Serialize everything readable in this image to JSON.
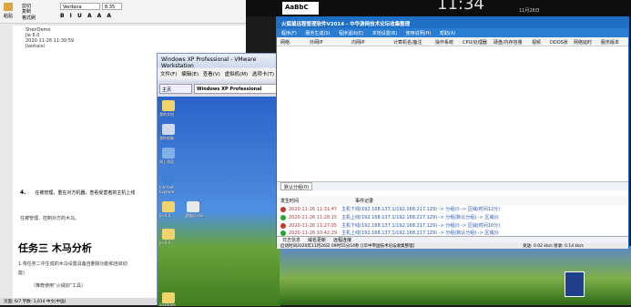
{
  "desktop": {
    "style_sample": "AaBbC",
    "clock_partial": "11:34",
    "date_partial": "11月26日"
  },
  "word": {
    "toolbar": {
      "paste": "粘贴",
      "cut": "剪切",
      "copy": "复制",
      "format_painter": "格式刷",
      "font_name": "Verdana",
      "font_size": "8.35"
    },
    "lines": {
      "l1": "ShenDemo",
      "l2": "Jie 6.0",
      "l3": "2020-11-26  11:30:59",
      "l4": "Jiaohaixi",
      "step4_num": "4.",
      "step4": "在被管理，重在对方机器，查看受害者的主机上线",
      "admin_note": "在被管理，控制对方的木马。",
      "heading": "任务三  木马分析",
      "p1": "1.将任务二中生成的木马设置具备自删除功能和自启动",
      "p2": "能)",
      "p3": "（推荐使用“火绒剑”工具）",
      "status": "页面: 6/7    字数: 1,014    中文(中国)"
    }
  },
  "vmware": {
    "title": "Windows XP Professional - VMware Workstation",
    "menu": [
      "文件(F)",
      "编辑(E)",
      "查看(V)",
      "虚拟机(M)",
      "选项卡(T)"
    ],
    "tabs": [
      "主页",
      "Windows XP Professional"
    ],
    "icons": [
      "我的文档",
      "我的电脑",
      "网上邻居",
      "Internet Explorer",
      "Jie 6.0",
      "国服机.exe",
      "Jie 6.0",
      "Shadows"
    ]
  },
  "app": {
    "title": "火狐鼠远程管理软件V2014  - 中华游网技术论坛收集整理",
    "menu": [
      "程序(F)",
      "服务生成(S)",
      "程序退出(E)",
      "本地设置(B)",
      "使用说明(H)",
      "帮助(A)"
    ],
    "columns": [
      "网络",
      "外网IP",
      "内网IP",
      "计算机名/备注",
      "操作系统",
      "CPU/处理器",
      "硬盘/内存容量",
      "视频",
      "DDOS状",
      "网络延时",
      "服务版本"
    ],
    "group_tab": "默认分组(0)",
    "log_headers": {
      "time": "发生时间",
      "event": "事件记录"
    },
    "log": [
      {
        "time": "2020-11-26 11:31:47",
        "event": "主机下线(192.168.137.1/192.168.217.129) -> 分组(I) -> 区域(时间12分)",
        "color": "#c0392b"
      },
      {
        "time": "2020-11-26 11:28:15",
        "event": "主机上线(192.168.137.1/192.168.217.129) -> 分组(默认分组) -> 区域(I)",
        "color": "#27a533"
      },
      {
        "time": "2020-11-26 11:27:05",
        "event": "主机下线(192.168.137.1/192.168.217.129) -> 分组(I) -> 区域(时间10分)",
        "color": "#c0392b"
      },
      {
        "time": "2020-11-26 10:42:29",
        "event": "主机上线(192.168.137.1/192.168.217.129) -> 分组(默认分组) -> 区域(I)",
        "color": "#27a533"
      }
    ],
    "log_tabs": [
      "日志信息",
      "域名更新",
      "远程连接"
    ],
    "status_left": "启动时间2020年11月26日 09时55分54秒 [[华中帝国技术论坛收集整理]",
    "status_right": "发送: 0.02 kb/s  接收: 0.14 kb/s"
  }
}
